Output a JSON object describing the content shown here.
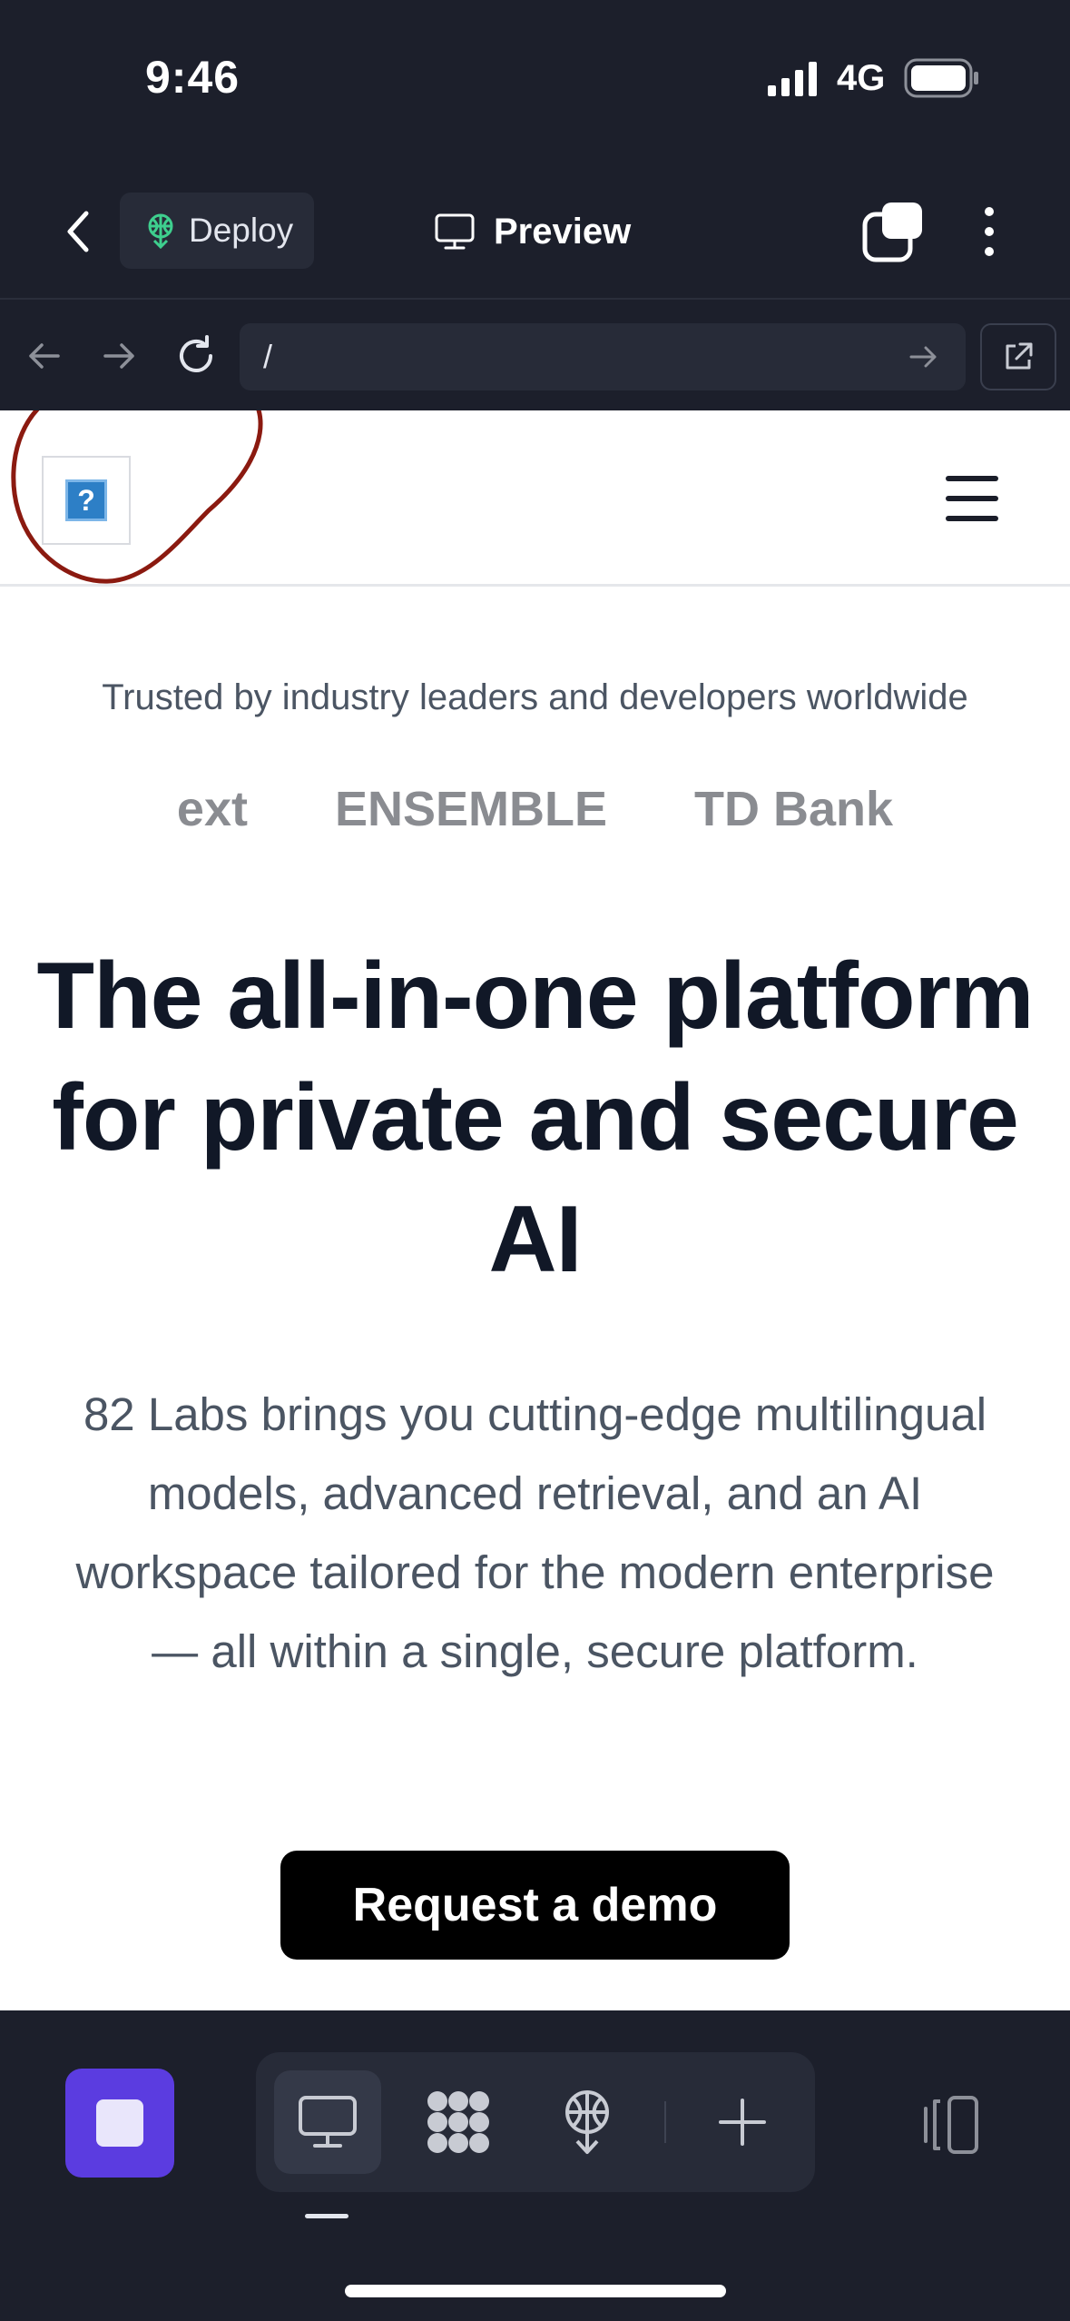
{
  "status_bar": {
    "time": "9:46",
    "network": "4G"
  },
  "header": {
    "deploy_label": "Deploy",
    "preview_label": "Preview"
  },
  "browser": {
    "url": "/"
  },
  "site": {
    "trusted_text": "Trusted by industry leaders and developers worldwide",
    "partner_logos": [
      "ext",
      "ENSEMBLE",
      "TD Bank"
    ],
    "hero_title": "The all-in-one platform for private and secure AI",
    "hero_description": "82 Labs brings you cutting-edge multilingual models, advanced retrieval, and an AI workspace tailored for the modern enterprise — all within a single, secure platform.",
    "cta_label": "Request a demo",
    "logo_placeholder": "?"
  },
  "colors": {
    "app_bg": "#1c1f2b",
    "stop_button": "#5b3ce0",
    "annotation": "#8b1a10",
    "deploy_icon": "#3ecf8e"
  },
  "icons": [
    "back-icon",
    "deploy-icon",
    "monitor-icon",
    "tabs-icon",
    "more-icon",
    "arrow-left-icon",
    "arrow-right-icon",
    "reload-icon",
    "go-icon",
    "external-link-icon",
    "menu-icon",
    "stop-icon",
    "desktop-icon",
    "apps-icon",
    "deploy-icon",
    "plus-icon",
    "panel-icon"
  ]
}
